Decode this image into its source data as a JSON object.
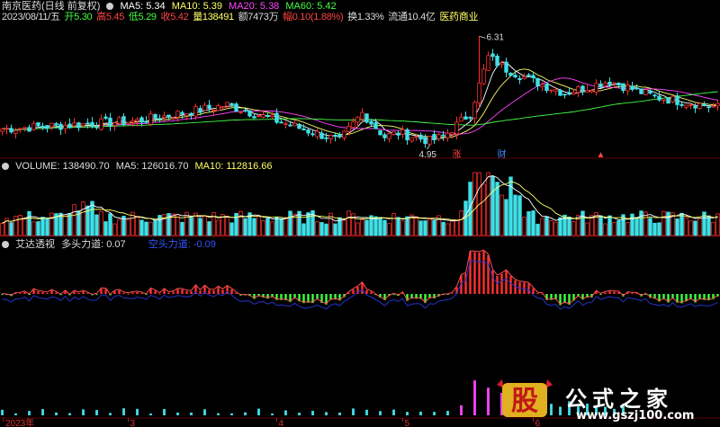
{
  "header": {
    "title": "南京医药(日线 前复权)",
    "ma_items": [
      {
        "label": "MA5: 5.34",
        "color": "#ffffff"
      },
      {
        "label": "MA10: 5.39",
        "color": "#ffff66"
      },
      {
        "label": "MA20: 5.38",
        "color": "#ff44ff"
      },
      {
        "label": "MA60: 5.42",
        "color": "#44ff44"
      }
    ],
    "quote_items": [
      {
        "label": "2023/08/11/五",
        "color": "#dddddd"
      },
      {
        "label": "开5.30",
        "color": "#44ff44"
      },
      {
        "label": "高5.45",
        "color": "#ff4444"
      },
      {
        "label": "低5.29",
        "color": "#44ff44"
      },
      {
        "label": "收5.42",
        "color": "#ff4444"
      },
      {
        "label": "量138491",
        "color": "#ffff66"
      },
      {
        "label": "额7473万",
        "color": "#dddddd"
      },
      {
        "label": "幅0.10(1.88%)",
        "color": "#ff4444"
      },
      {
        "label": "换1.33%",
        "color": "#dddddd"
      },
      {
        "label": "流通10.4亿",
        "color": "#dddddd"
      },
      {
        "label": "医药商业",
        "color": "#ffff66"
      }
    ]
  },
  "volume_header": [
    {
      "label": "VOLUME: 138490.70",
      "color": "#dddddd"
    },
    {
      "label": "MA5: 126016.70",
      "color": "#dddddd"
    },
    {
      "label": "MA10: 112816.66",
      "color": "#ffff66"
    }
  ],
  "indicator_header": [
    {
      "label": "艾达透视",
      "color": "#dddddd"
    },
    {
      "label": "多头力道: 0.07",
      "color": "#dddddd"
    },
    {
      "label": "空头力道: -0.09",
      "color": "#3355ff"
    }
  ],
  "price_annotations": {
    "high": "6.31",
    "low": "4.95",
    "markers": [
      {
        "label": "涨",
        "color": "#ff4444"
      },
      {
        "label": "财",
        "color": "#4488ff"
      },
      {
        "label": "▲",
        "color": "#ff4444"
      }
    ]
  },
  "x_axis_labels": [
    "2023年",
    "3",
    "4",
    "5",
    "6"
  ],
  "logo": {
    "badge": "股",
    "site": "公式之家",
    "url": "www.gszj100.com"
  },
  "chart_data": {
    "type": "candlestick",
    "n_days": 160,
    "price_range": [
      4.85,
      6.45
    ],
    "key_points": [
      {
        "day": 0,
        "close": 5.15
      },
      {
        "day": 30,
        "close": 5.25
      },
      {
        "day": 50,
        "close": 5.45
      },
      {
        "day": 75,
        "close": 5.0
      },
      {
        "day": 80,
        "close": 5.35
      },
      {
        "day": 85,
        "close": 5.05
      },
      {
        "day": 88,
        "close": 5.1
      },
      {
        "day": 95,
        "close": 5.0
      },
      {
        "day": 98,
        "close": 5.05
      },
      {
        "day": 104,
        "close": 5.35
      },
      {
        "day": 108,
        "close": 6.05
      },
      {
        "day": 112,
        "close": 5.9
      },
      {
        "day": 118,
        "close": 5.75
      },
      {
        "day": 125,
        "close": 5.6
      },
      {
        "day": 135,
        "close": 5.75
      },
      {
        "day": 145,
        "close": 5.55
      },
      {
        "day": 159,
        "close": 5.42
      }
    ],
    "month_ticks": [
      {
        "label": "2023年",
        "day": 0
      },
      {
        "label": "3",
        "day": 28
      },
      {
        "label": "4",
        "day": 61
      },
      {
        "label": "5",
        "day": 89
      },
      {
        "label": "6",
        "day": 118
      }
    ]
  }
}
